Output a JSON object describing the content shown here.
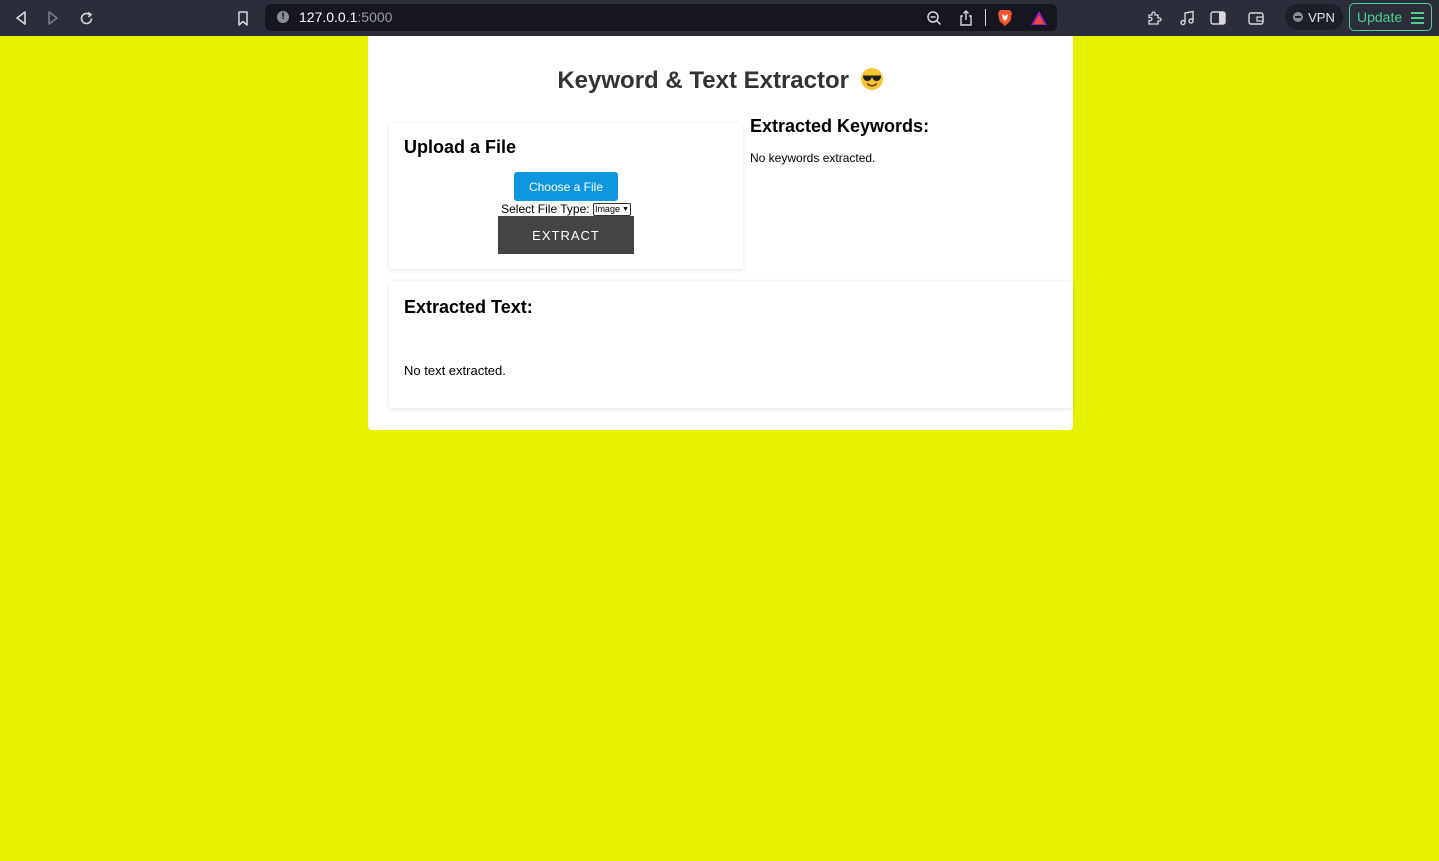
{
  "browser": {
    "url_host": "127.0.0.1",
    "url_port": ":5000",
    "vpn_label": "VPN",
    "update_label": "Update",
    "colors": {
      "toolbar": "#2b2d3a",
      "urlbar": "#15161f",
      "update_accent": "#4fd08e"
    },
    "icons": [
      "back-icon",
      "forward-icon",
      "reload-icon",
      "bookmark-icon",
      "site-info-icon",
      "zoom-icon",
      "share-icon",
      "brave-shields-icon",
      "brave-rewards-icon",
      "extensions-icon",
      "media-icon",
      "sidebar-icon",
      "wallet-icon",
      "vpn-icon",
      "menu-icon"
    ]
  },
  "page": {
    "title": "Keyword & Text Extractor",
    "title_emoji": "smiling-face-with-sunglasses-icon",
    "background_color": "#e6f200",
    "upload": {
      "heading": "Upload a File",
      "choose_label": "Choose a File",
      "file_type_label": "Select File Type:",
      "file_type_value": "Image",
      "extract_label": "EXTRACT",
      "colors": {
        "choose_button": "#0e97de",
        "extract_button": "#444444"
      }
    },
    "keywords": {
      "heading": "Extracted Keywords:",
      "empty_text": "No keywords extracted."
    },
    "text": {
      "heading": "Extracted Text:",
      "empty_text": "No text extracted."
    }
  }
}
